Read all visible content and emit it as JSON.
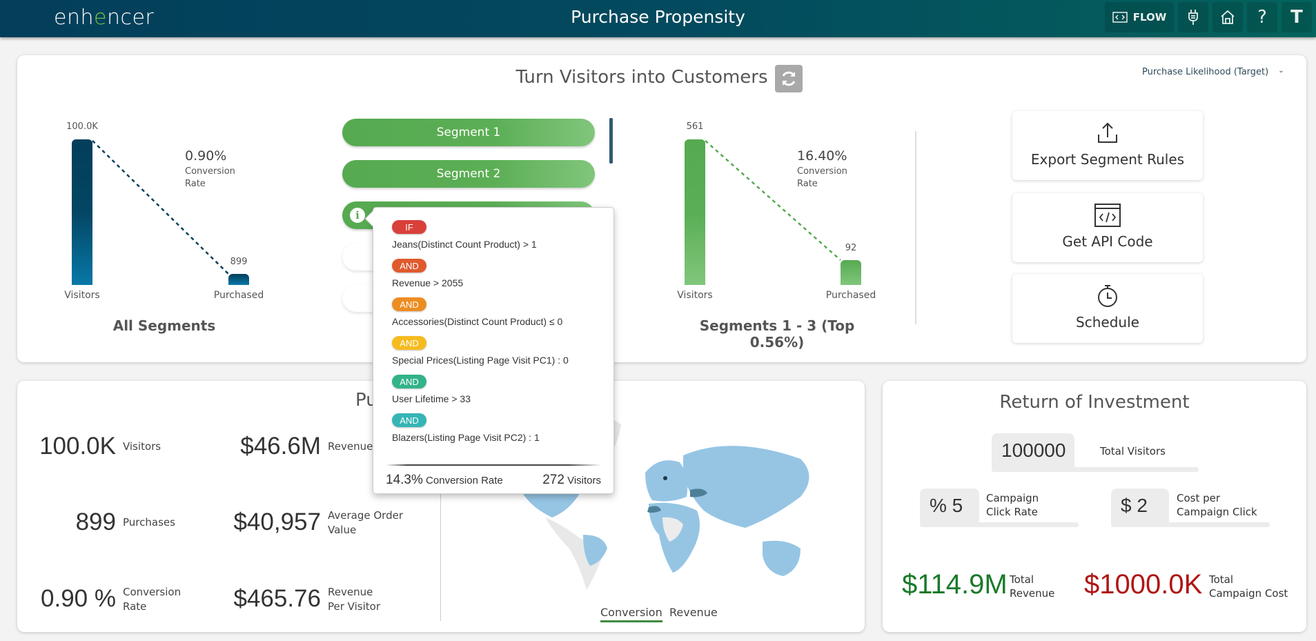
{
  "header": {
    "logo_pre": "enh",
    "logo_accent": "e",
    "logo_post": "ncer",
    "title": "Purchase Propensity",
    "nav": [
      {
        "icon": "code-icon",
        "label": "FLOW"
      },
      {
        "icon": "plug-icon",
        "label": ""
      },
      {
        "icon": "home-icon",
        "label": ""
      },
      {
        "icon": "help-icon",
        "label": "?"
      },
      {
        "icon": "user-avatar",
        "label": "T"
      }
    ]
  },
  "top_card": {
    "title": "Turn Visitors into Customers",
    "target_select": "Purchase Likelihood (Target)",
    "all_segments": {
      "title": "All Segments",
      "visitors_value": "100.0K",
      "purchased_value": "899",
      "visitors_label": "Visitors",
      "purchased_label": "Purchased",
      "conversion_rate": "0.90%",
      "conversion_label_1": "Conversion",
      "conversion_label_2": "Rate",
      "purchased_ratio": 0.009
    },
    "segments": [
      {
        "label": "Segment 1"
      },
      {
        "label": "Segment 2"
      },
      {
        "label": ""
      },
      {
        "label": ""
      },
      {
        "label": ""
      }
    ],
    "selected_segments": {
      "title": "Segments 1 - 3 (Top 0.56%)",
      "visitors_value": "561",
      "purchased_value": "92",
      "visitors_label": "Visitors",
      "purchased_label": "Purchased",
      "conversion_rate": "16.40%",
      "conversion_label_1": "Conversion",
      "conversion_label_2": "Rate",
      "purchased_ratio": 0.164
    },
    "actions": [
      {
        "icon": "upload-icon",
        "label": "Export Segment Rules"
      },
      {
        "icon": "code-window-icon",
        "label": "Get API Code"
      },
      {
        "icon": "stopwatch-icon",
        "label": "Schedule"
      }
    ]
  },
  "tooltip": {
    "rules": [
      {
        "op": "IF",
        "color": "#d9403a",
        "text": "Jeans(Distinct Count Product) > 1"
      },
      {
        "op": "AND",
        "color": "#e05a2e",
        "text": "Revenue > 2055"
      },
      {
        "op": "AND",
        "color": "#ec8d22",
        "text": "Accessories(Distinct Count Product) ≤ 0"
      },
      {
        "op": "AND",
        "color": "#f5bb1f",
        "text": "Special Prices(Listing Page Visit PC1) : 0"
      },
      {
        "op": "AND",
        "color": "#33b38a",
        "text": "User Lifetime > 33"
      },
      {
        "op": "AND",
        "color": "#36b5b5",
        "text": "Blazers(Listing Page Visit PC2) : 1"
      }
    ],
    "conversion_value": "14.3%",
    "conversion_label": "Conversion Rate",
    "visitors_value": "272",
    "visitors_label": "Visitors"
  },
  "performance": {
    "title": "Pu",
    "kpis": [
      {
        "value": "100.0K",
        "label1": "Visitors",
        "label2": ""
      },
      {
        "value": "$46.6M",
        "label1": "Revenue",
        "label2": ""
      },
      {
        "value": "899",
        "label1": "Purchases",
        "label2": ""
      },
      {
        "value": "$40,957",
        "label1": "Average Order",
        "label2": "Value"
      },
      {
        "value": "0.90 %",
        "label1": "Conversion",
        "label2": "Rate"
      },
      {
        "value": "$465.76",
        "label1": "Revenue",
        "label2": "Per Visitor"
      }
    ],
    "map_tabs": [
      {
        "label": "Conversion",
        "active": true
      },
      {
        "label": "Revenue",
        "active": false
      }
    ]
  },
  "roi": {
    "title": "Return of Investment",
    "total_visitors_value": "100000",
    "total_visitors_label": "Total Visitors",
    "click_rate_value": "% 5",
    "click_rate_label1": "Campaign",
    "click_rate_label2": "Click Rate",
    "cost_per_click_value": "$ 2",
    "cost_per_click_label1": "Cost per",
    "cost_per_click_label2": "Campaign Click",
    "total_revenue_value": "$114.9M",
    "total_revenue_label1": "Total",
    "total_revenue_label2": "Revenue",
    "total_revenue_color": "#1a7a2a",
    "total_cost_value": "$1000.0K",
    "total_cost_label1": "Total",
    "total_cost_label2": "Campaign Cost",
    "total_cost_color": "#b01616"
  }
}
